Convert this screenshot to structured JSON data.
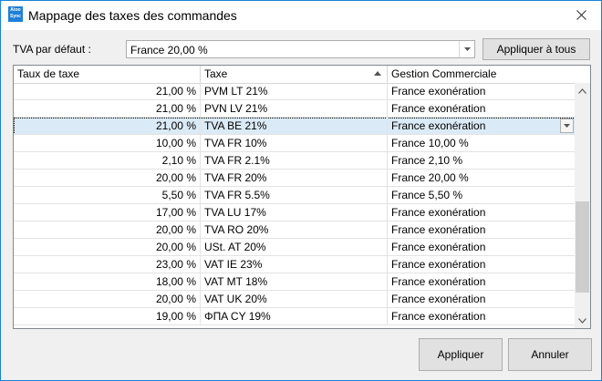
{
  "window": {
    "title": "Mappage des taxes des commandes",
    "app_icon_text": "Atoo Sync"
  },
  "default_tva": {
    "label": "TVA par défaut :",
    "value": "France 20,00 %",
    "apply_all_label": "Appliquer à tous"
  },
  "grid": {
    "columns": [
      "Taux de taxe",
      "Taxe",
      "Gestion Commerciale"
    ],
    "sorted_column": "Taxe",
    "sort_direction": "ascending",
    "selected_row_index": 2,
    "rows": [
      {
        "rate": "21,00 %",
        "tax": "PVM LT 21%",
        "mapping": "France exonération"
      },
      {
        "rate": "21,00 %",
        "tax": "PVN LV 21%",
        "mapping": "France exonération"
      },
      {
        "rate": "21,00 %",
        "tax": "TVA BE 21%",
        "mapping": "France exonération"
      },
      {
        "rate": "10,00 %",
        "tax": "TVA FR 10%",
        "mapping": "France 10,00 %"
      },
      {
        "rate": "2,10 %",
        "tax": "TVA FR 2.1%",
        "mapping": "France 2,10 %"
      },
      {
        "rate": "20,00 %",
        "tax": "TVA FR 20%",
        "mapping": "France 20,00 %"
      },
      {
        "rate": "5,50 %",
        "tax": "TVA FR 5.5%",
        "mapping": "France 5,50 %"
      },
      {
        "rate": "17,00 %",
        "tax": "TVA LU 17%",
        "mapping": "France exonération"
      },
      {
        "rate": "20,00 %",
        "tax": "TVA RO 20%",
        "mapping": "France exonération"
      },
      {
        "rate": "20,00 %",
        "tax": "USt. AT 20%",
        "mapping": "France exonération"
      },
      {
        "rate": "23,00 %",
        "tax": "VAT IE 23%",
        "mapping": "France exonération"
      },
      {
        "rate": "18,00 %",
        "tax": "VAT MT 18%",
        "mapping": "France exonération"
      },
      {
        "rate": "20,00 %",
        "tax": "VAT UK 20%",
        "mapping": "France exonération"
      },
      {
        "rate": "19,00 %",
        "tax": "ΦΠΑ CY 19%",
        "mapping": "France exonération"
      }
    ]
  },
  "footer": {
    "apply_label": "Appliquer",
    "cancel_label": "Annuler"
  },
  "colors": {
    "accent": "#1883d7",
    "selection": "#dbeaf7"
  }
}
